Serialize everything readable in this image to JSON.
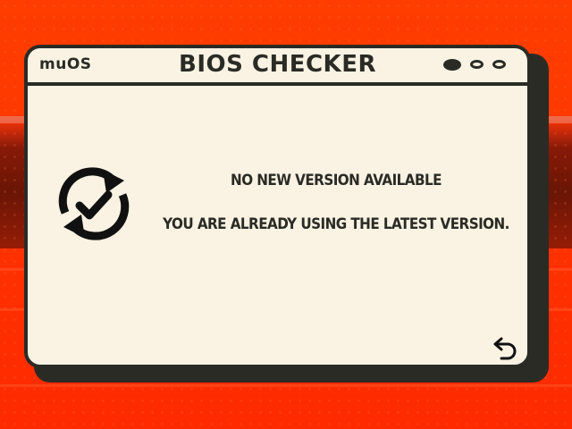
{
  "window": {
    "brand": "muOS",
    "title": "BIOS CHECKER",
    "controls": [
      "minimize",
      "maximize",
      "close"
    ]
  },
  "content": {
    "status_icon": "sync-check-icon",
    "message_line1": "NO NEW VERSION AVAILABLE",
    "message_line2": "YOU ARE ALREADY USING THE LATEST VERSION."
  },
  "footer": {
    "back_icon": "back-arrow-icon"
  },
  "colors": {
    "background": "#ff3a00",
    "window_bg": "#faf3e3",
    "border": "#2b2b25",
    "text": "#2b2b25"
  }
}
